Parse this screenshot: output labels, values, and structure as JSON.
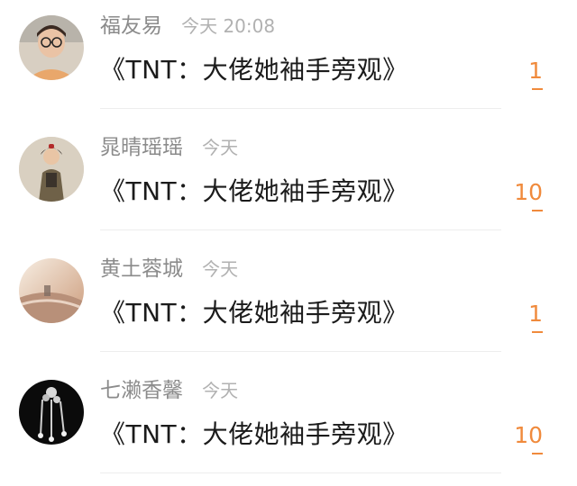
{
  "feed": {
    "items": [
      {
        "username": "福友易",
        "time": "今天 20:08",
        "title": "《TNT：大佬她袖手旁观》",
        "badge": "1",
        "avatar_icon": "avatar-person-glasses"
      },
      {
        "username": "晁晴瑶瑶",
        "time": "今天",
        "title": "《TNT：大佬她袖手旁观》",
        "badge": "10",
        "avatar_icon": "avatar-girl-outfit"
      },
      {
        "username": "黄土蓉城",
        "time": "今天",
        "title": "《TNT：大佬她袖手旁观》",
        "badge": "1",
        "avatar_icon": "avatar-sunset-beach"
      },
      {
        "username": "七濑香馨",
        "time": "今天",
        "title": "《TNT：大佬她袖手旁观》",
        "badge": "10",
        "avatar_icon": "avatar-jewelry"
      }
    ]
  },
  "colors": {
    "badge": "#f08a3c",
    "username": "#8b8b8b",
    "time": "#b1b1b1",
    "title": "#1b1b1b"
  }
}
